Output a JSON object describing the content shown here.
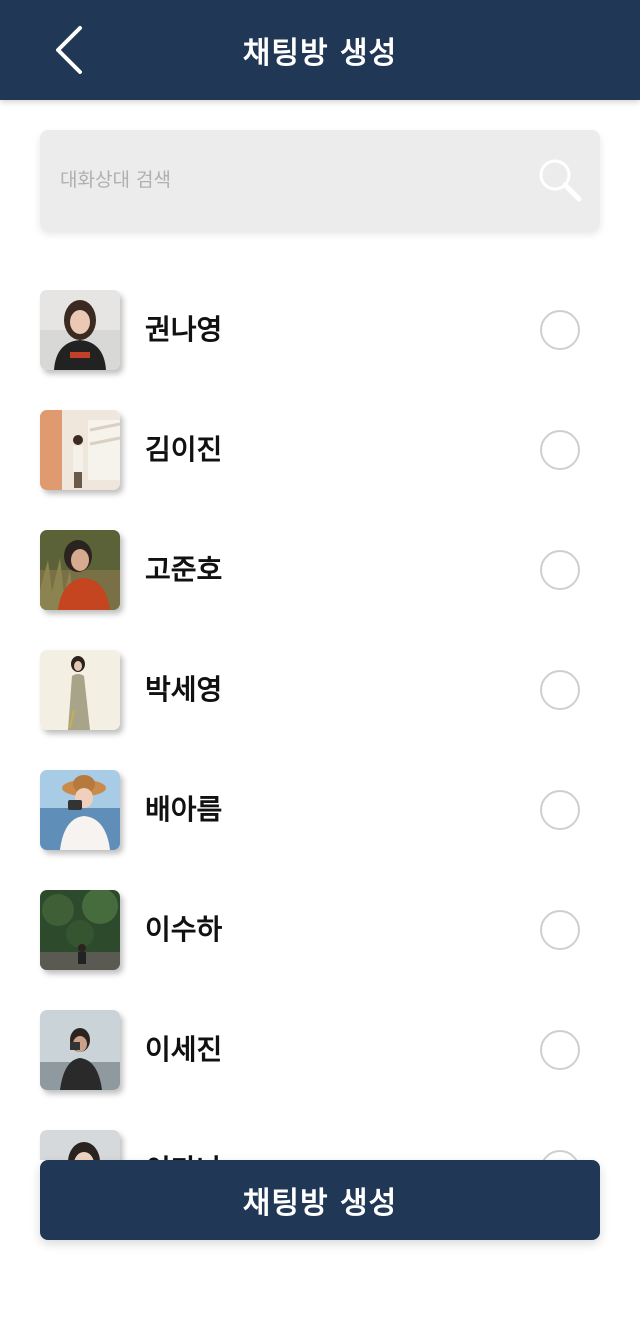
{
  "header": {
    "title": "채팅방 생성",
    "back_icon": "chevron-left-icon"
  },
  "search": {
    "placeholder": "대화상대 검색",
    "value": "",
    "icon": "search-icon"
  },
  "contacts": [
    {
      "name": "권나영",
      "selected": false
    },
    {
      "name": "김이진",
      "selected": false
    },
    {
      "name": "고준호",
      "selected": false
    },
    {
      "name": "박세영",
      "selected": false
    },
    {
      "name": "배아름",
      "selected": false
    },
    {
      "name": "이수하",
      "selected": false
    },
    {
      "name": "이세진",
      "selected": false
    },
    {
      "name": "이가나",
      "selected": false
    }
  ],
  "footer": {
    "create_label": "채팅방 생성"
  },
  "colors": {
    "primary": "#203756",
    "search_bg": "#ececec",
    "radio_border": "#cfcfcf"
  }
}
